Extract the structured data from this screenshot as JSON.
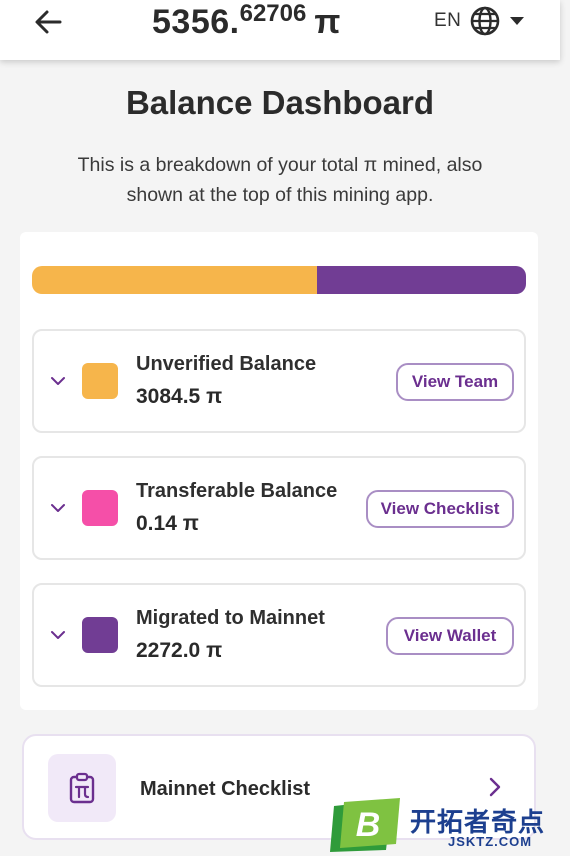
{
  "header": {
    "total_integer": "5356.",
    "total_decimal": "62706",
    "total_symbol": "π",
    "language_code": "EN",
    "icons": {
      "back": "arrow-left-icon",
      "language": "globe-icon",
      "dropdown": "caret-down-icon"
    }
  },
  "page": {
    "title": "Balance Dashboard",
    "subtitle": "This is a breakdown of your total π mined, also shown at the top of this mining app."
  },
  "balance_bar": {
    "segments": [
      {
        "name": "Unverified",
        "fraction": 0.576,
        "color": "#F6B54B"
      },
      {
        "name": "Transferable",
        "fraction": 0.0,
        "color": "#F54FA8"
      },
      {
        "name": "Migrated",
        "fraction": 0.424,
        "color": "#713D94"
      }
    ]
  },
  "balances": [
    {
      "label": "Unverified Balance",
      "value": "3084.5 π",
      "button": "View Team",
      "color": "#F6B54B"
    },
    {
      "label": "Transferable Balance",
      "value": "0.14 π",
      "button": "View Checklist",
      "color": "#F54FA8"
    },
    {
      "label": "Migrated to Mainnet",
      "value": "2272.0 π",
      "button": "View Wallet",
      "color": "#713D94"
    }
  ],
  "checklist": {
    "label": "Mainnet Checklist",
    "icons": {
      "main": "clipboard-pi-icon",
      "arrow": "chevron-right-icon"
    }
  },
  "watermark": {
    "logo_letter": "B",
    "text": "开拓者奇点",
    "subtext": "JSKTZ.COM"
  },
  "colors": {
    "accent": "#6B2F8F",
    "accent_border": "#A98EC4",
    "background": "#F4F4F4",
    "card": "#FFFFFF"
  }
}
